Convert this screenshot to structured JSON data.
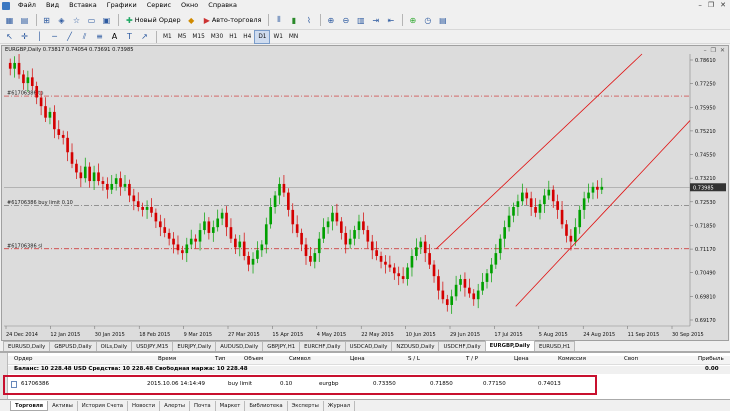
{
  "menu": [
    "Файл",
    "Вид",
    "Вставка",
    "Графики",
    "Сервис",
    "Окно",
    "Справка"
  ],
  "toolbar": {
    "new_order": "Новый Ордер",
    "autotrading": "Авто-торговля"
  },
  "timeframes": [
    "M1",
    "M5",
    "M15",
    "M30",
    "H1",
    "H4",
    "D1",
    "W1",
    "MN"
  ],
  "active_timeframe": "D1",
  "chart": {
    "title": "EURGBP,Daily  0.73817 0.74054 0.73691 0.73985",
    "tp_label": "#61706386 tp",
    "buylimit_label": "#61706386 buy limit 0.10",
    "sl_label": "#61706386 sl",
    "price_badge": "0.73985",
    "price_ticks": [
      "0.78610",
      "0.77250",
      "0.75950",
      "0.75210",
      "0.74550",
      "0.73210",
      "0.72530",
      "0.71850",
      "0.71170",
      "0.70490",
      "0.69810",
      "0.69170"
    ],
    "date_ticks": [
      "24 Dec 2014",
      "12 Jan 2015",
      "30 Jan 2015",
      "18 Feb 2015",
      "9 Mar 2015",
      "27 Mar 2015",
      "15 Apr 2015",
      "4 May 2015",
      "22 May 2015",
      "10 Jun 2015",
      "29 Jun 2015",
      "17 Jul 2015",
      "5 Aug 2015",
      "24 Aug 2015",
      "11 Sep 2015",
      "30 Sep 2015"
    ],
    "colors": {
      "bull": "#00a000",
      "bear": "#d40000",
      "tp_line": "#cc2222",
      "sl_line": "#cc2222",
      "channel": "#e01010"
    }
  },
  "chart_tabs": [
    "EURUSD,Daily",
    "GBPUSD,Daily",
    "OILs,Daily",
    "USDJPY,M15",
    "EURJPY,Daily",
    "AUDUSD,Daily",
    "GBPJPY,H1",
    "EURCHF,Daily",
    "USDCAD,Daily",
    "NZDUSD,Daily",
    "USDCHF,Daily",
    "EURGBP,Daily",
    "EURUSD,H1"
  ],
  "active_chart_tab": "EURGBP,Daily",
  "terminal": {
    "columns": [
      "Ордер",
      "Время",
      "Тип",
      "Объем",
      "Символ",
      "Цена",
      "S / L",
      "T / P",
      "Цена",
      "Комиссия",
      "Своп",
      "Прибыль"
    ],
    "balance_text": "Баланс: 10 228.48 USD  Средства: 10 228.48  Свободная маржа: 10 228.48",
    "balance_profit": "0.00",
    "order": {
      "id": "61706386",
      "time": "2015.10.06 14:14:49",
      "type": "buy limit",
      "volume": "0.10",
      "symbol": "eurgbp",
      "price": "0.73350",
      "sl": "0.71850",
      "tp": "0.77150",
      "cur_price": "0.74013"
    },
    "vertical_label": "Терминал"
  },
  "bottom_tabs": [
    "Торговля",
    "Активы",
    "История Счета",
    "Новости",
    "Алерты",
    "Почта",
    "Маркет",
    "Библиотека",
    "Эксперты",
    "Журнал"
  ],
  "active_bottom_tab": "Торговля",
  "chart_data": {
    "type": "candlestick",
    "title": "EURGBP,Daily",
    "ylim": [
      0.6917,
      0.7861
    ],
    "levels": {
      "tp": 0.7715,
      "buy_limit": 0.7335,
      "sl": 0.7185,
      "current": 0.73985
    },
    "closes": [
      0.781,
      0.783,
      0.779,
      0.776,
      0.778,
      0.775,
      0.771,
      0.768,
      0.764,
      0.766,
      0.76,
      0.758,
      0.757,
      0.752,
      0.748,
      0.745,
      0.743,
      0.747,
      0.742,
      0.745,
      0.742,
      0.741,
      0.739,
      0.741,
      0.743,
      0.74,
      0.741,
      0.737,
      0.735,
      0.733,
      0.732,
      0.733,
      0.731,
      0.728,
      0.726,
      0.724,
      0.722,
      0.72,
      0.718,
      0.717,
      0.72,
      0.722,
      0.721,
      0.725,
      0.728,
      0.724,
      0.726,
      0.729,
      0.731,
      0.726,
      0.722,
      0.719,
      0.721,
      0.716,
      0.713,
      0.715,
      0.718,
      0.72,
      0.727,
      0.733,
      0.737,
      0.741,
      0.738,
      0.732,
      0.727,
      0.724,
      0.72,
      0.716,
      0.714,
      0.717,
      0.722,
      0.726,
      0.728,
      0.731,
      0.728,
      0.724,
      0.72,
      0.722,
      0.725,
      0.728,
      0.725,
      0.721,
      0.718,
      0.716,
      0.714,
      0.713,
      0.712,
      0.71,
      0.709,
      0.708,
      0.712,
      0.716,
      0.719,
      0.721,
      0.717,
      0.713,
      0.709,
      0.704,
      0.701,
      0.699,
      0.702,
      0.706,
      0.708,
      0.705,
      0.703,
      0.701,
      0.704,
      0.707,
      0.71,
      0.713,
      0.717,
      0.722,
      0.726,
      0.73,
      0.733,
      0.735,
      0.738,
      0.736,
      0.733,
      0.731,
      0.734,
      0.737,
      0.739,
      0.735,
      0.732,
      0.727,
      0.723,
      0.721,
      0.726,
      0.732,
      0.736,
      0.738,
      0.74,
      0.739,
      0.74
    ]
  }
}
